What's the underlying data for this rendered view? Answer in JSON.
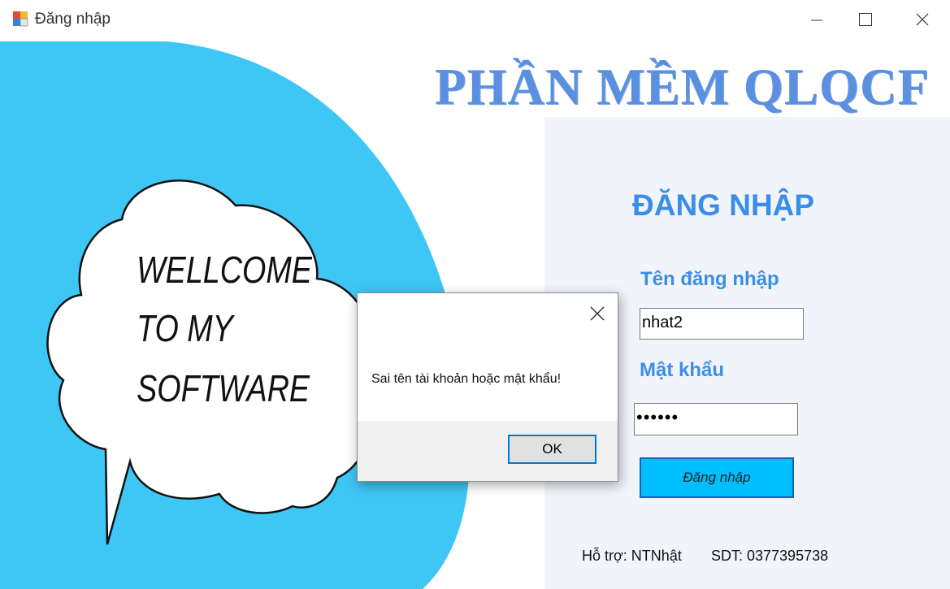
{
  "window": {
    "title": "Đăng nhập",
    "controls": {
      "minimize": "minimize-icon",
      "maximize": "maximize-icon",
      "close": "close-icon"
    }
  },
  "app_title": "PHẦN MỀM QLQCF",
  "welcome_bubble": {
    "lines": [
      "WELLCOME",
      "TO MY",
      "SOFTWARE"
    ]
  },
  "login": {
    "heading": "ĐĂNG NHẬP",
    "username_label": "Tên đăng nhập",
    "username_value": "nhat2",
    "password_label": "Mật khẩu",
    "password_value": "••••••",
    "submit_label": "Đăng nhập"
  },
  "footer": {
    "support": "Hỗ trợ: NTNhật",
    "phone": "SDT: 0377395738"
  },
  "dialog": {
    "message": "Sai tên tài khoản hoặc mật khẩu!",
    "ok_label": "OK"
  },
  "colors": {
    "accent_blue": "#3b8ee8",
    "art_blue": "#3ec6f5",
    "button_blue": "#00bfff",
    "title_blue": "#5b8fe0"
  }
}
